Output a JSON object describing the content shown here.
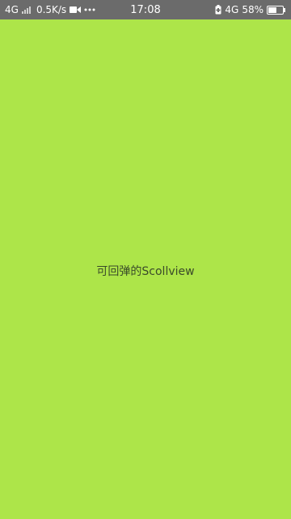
{
  "status_bar": {
    "network_left": "4G",
    "data_speed": "0.5K/s",
    "time": "17:08",
    "network_right": "4G",
    "battery_percent": "58%",
    "battery_level": 0.58
  },
  "content": {
    "label": "可回弹的Scollview"
  },
  "colors": {
    "background": "#ade549",
    "status_bar": "#6b6b6b"
  }
}
